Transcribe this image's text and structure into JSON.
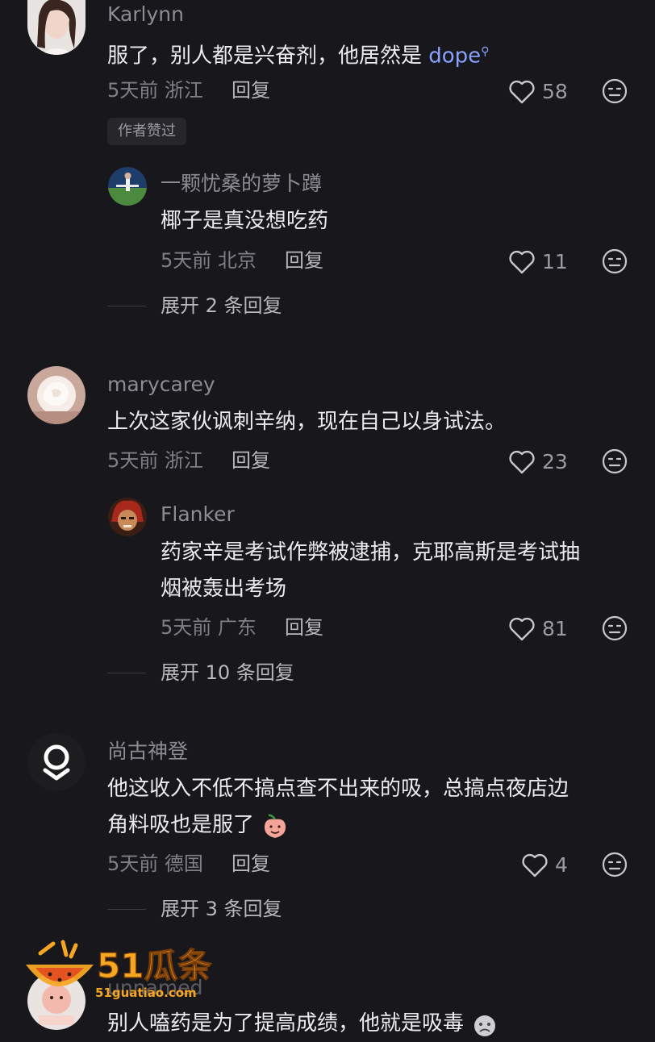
{
  "comments": [
    {
      "user": "Karlynn",
      "text_plain": "服了，别人都是兴奋剂，他居然是 ",
      "text_link": "dope",
      "time": "5天前",
      "location": "浙江",
      "reply_label": "回复",
      "likes": "58",
      "badge": "作者赞过",
      "replies": [
        {
          "user": "一颗忧桑的萝卜蹲",
          "text": "椰子是真没想吃药",
          "time": "5天前",
          "location": "北京",
          "reply_label": "回复",
          "likes": "11"
        }
      ],
      "expand_label": "展开 2 条回复"
    },
    {
      "user": "marycarey",
      "text": "上次这家伙讽刺辛纳，现在自己以身试法。",
      "time": "5天前",
      "location": "浙江",
      "reply_label": "回复",
      "likes": "23",
      "replies": [
        {
          "user": "Flanker",
          "text_line1": "药家辛是考试作弊被逮捕，克耶高斯是考试抽",
          "text_line2": "烟被轰出考场",
          "time": "5天前",
          "location": "广东",
          "reply_label": "回复",
          "likes": "81"
        }
      ],
      "expand_label": "展开 10 条回复"
    },
    {
      "user": "尚古神登",
      "text_line1": "他这收入不低不搞点查不出来的吸，总搞点夜店边",
      "text_line2": "角料吸也是服了",
      "time": "5天前",
      "location": "德国",
      "reply_label": "回复",
      "likes": "4",
      "expand_label": "展开 3 条回复"
    },
    {
      "user": "unnamed",
      "text": "别人嗑药是为了提高成绩，他就是吸毒"
    }
  ],
  "watermark": {
    "brand": "51瓜条",
    "url": "51guatiao.com"
  },
  "icons": {
    "like": "heart-outline-icon",
    "dislike": "neutral-face-icon",
    "search": "search-icon"
  },
  "colors": {
    "background": "#17171c",
    "link": "#8aa2ff",
    "watermark": "#f5a623"
  }
}
